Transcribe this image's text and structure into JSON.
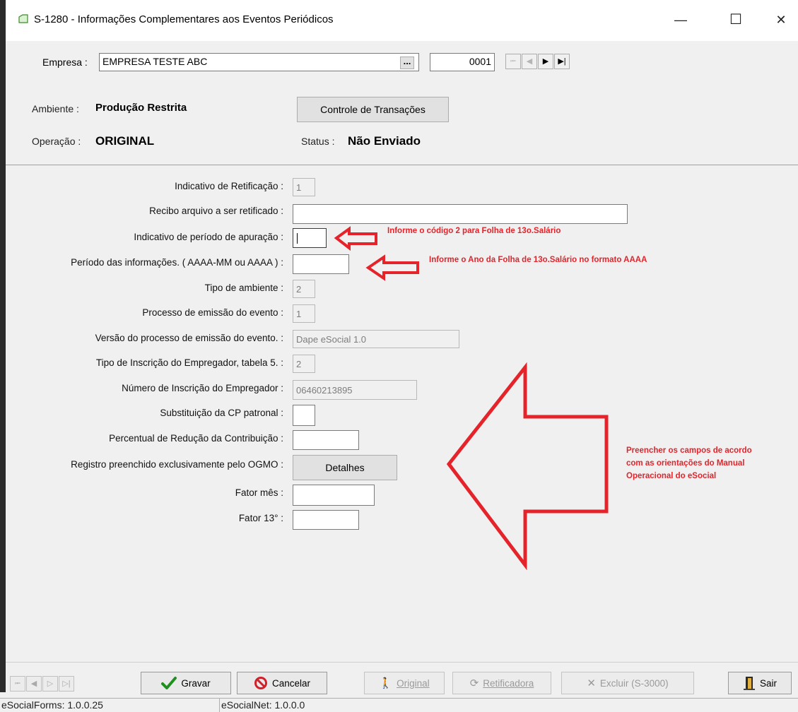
{
  "window": {
    "title": "S-1280 - Informações Complementares aos Eventos Periódicos",
    "minimize_glyph": "—",
    "maximize_glyph": "☐",
    "close_glyph": "✕"
  },
  "empresa": {
    "label": "Empresa :",
    "name_value": "EMPRESA TESTE ABC",
    "browse_label": "...",
    "code_value": "0001"
  },
  "ambiente": {
    "label": "Ambiente :",
    "value": "Produção Restrita"
  },
  "controle_button": "Controle de Transações",
  "operacao": {
    "label": "Operação :",
    "value": "ORIGINAL"
  },
  "status": {
    "label": "Status :",
    "value": "Não Enviado"
  },
  "form": {
    "indicativo_retificacao": {
      "label": "Indicativo de Retificação :",
      "value": "1"
    },
    "recibo": {
      "label": "Recibo arquivo a ser retificado :",
      "value": ""
    },
    "indicativo_periodo": {
      "label": "Indicativo de período de apuração :",
      "value": ""
    },
    "periodo_info": {
      "label": "Período das informações. ( AAAA-MM ou AAAA ) :",
      "value": ""
    },
    "tipo_ambiente": {
      "label": "Tipo de ambiente :",
      "value": "2"
    },
    "processo_emissao": {
      "label": "Processo de emissão do evento :",
      "value": "1"
    },
    "versao_processo": {
      "label": "Versão do processo de emissão do evento. :",
      "value": "Dape eSocial 1.0"
    },
    "tipo_inscricao": {
      "label": "Tipo de Inscrição do Empregador, tabela 5. :",
      "value": "2"
    },
    "numero_inscricao": {
      "label": "Número de Inscrição do Empregador :",
      "value": "06460213895"
    },
    "substituicao_cp": {
      "label": "Substituição da CP patronal :",
      "value": ""
    },
    "percentual_reducao": {
      "label": "Percentual de Redução da Contribuição :",
      "value": ""
    },
    "registro_ogmo": {
      "label": "Registro preenchido exclusivamente pelo OGMO :",
      "button": "Detalhes"
    },
    "fator_mes": {
      "label": "Fator mês :",
      "value": ""
    },
    "fator_13": {
      "label": "Fator 13° :",
      "value": ""
    }
  },
  "annotations": {
    "note1": "Informe o código 2 para Folha de 13o.Salário",
    "note2": "Informe o Ano da Folha de 13o.Salário no formato AAAA",
    "note3_line1": "Preencher os campos de acordo",
    "note3_line2": "com as orientações do Manual",
    "note3_line3": "Operacional do eSocial",
    "color": "#e4232a"
  },
  "toolbar": {
    "gravar": "Gravar",
    "cancelar": "Cancelar",
    "original": "Original",
    "retificadora": "Retificadora",
    "excluir": "Excluir (S-3000)",
    "sair": "Sair"
  },
  "statusbar": {
    "forms_version": "eSocialForms: 1.0.0.25",
    "net_version": "eSocialNet: 1.0.0.0"
  }
}
